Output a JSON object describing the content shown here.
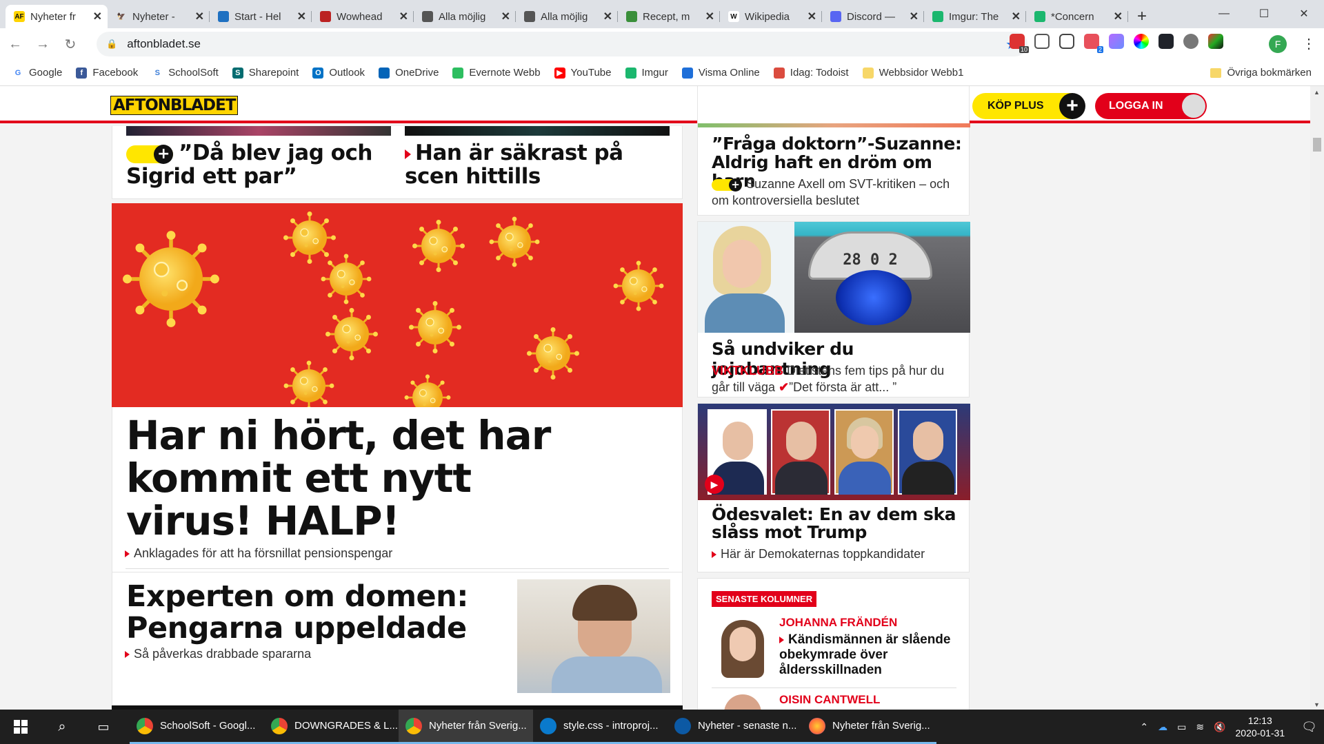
{
  "browser": {
    "tabs": [
      {
        "title": "Nyheter fr",
        "fav": "AF",
        "color": "#ffd400",
        "fcolor": "#111",
        "active": true
      },
      {
        "title": "Nyheter -",
        "fav": "🦅",
        "color": "#dee1e6",
        "fcolor": "#111"
      },
      {
        "title": "Start - Hel",
        "fav": "",
        "color": "#1e70c1",
        "fcolor": "#fff"
      },
      {
        "title": "Wowhead",
        "fav": "",
        "color": "#b22",
        "fcolor": "#fff"
      },
      {
        "title": "Alla möjlig",
        "fav": "",
        "color": "#555",
        "fcolor": "#fff"
      },
      {
        "title": "Alla möjlig",
        "fav": "",
        "color": "#555",
        "fcolor": "#fff"
      },
      {
        "title": "Recept, m",
        "fav": "",
        "color": "#3a8f3a",
        "fcolor": "#fff"
      },
      {
        "title": "Wikipedia",
        "fav": "W",
        "color": "#fff",
        "fcolor": "#111"
      },
      {
        "title": "Discord —",
        "fav": "",
        "color": "#5865f2",
        "fcolor": "#fff"
      },
      {
        "title": "Imgur: The",
        "fav": "",
        "color": "#1bb76e",
        "fcolor": "#fff"
      },
      {
        "title": "*Concern",
        "fav": "",
        "color": "#1bb76e",
        "fcolor": "#fff"
      }
    ],
    "new_tab": "+",
    "window_controls": [
      "—",
      "☐",
      "✕"
    ],
    "url": "aftonbladet.se",
    "profile_initial": "F",
    "ext_badges": {
      "first": "10",
      "second": "2"
    }
  },
  "bookmarks": [
    {
      "label": "Google",
      "icon": "G",
      "color": "#fff",
      "fcolor": "#4285f4"
    },
    {
      "label": "Facebook",
      "icon": "f",
      "color": "#3b5998",
      "fcolor": "#fff"
    },
    {
      "label": "SchoolSoft",
      "icon": "S",
      "color": "#fff",
      "fcolor": "#3b7dd8"
    },
    {
      "label": "Sharepoint",
      "icon": "S",
      "color": "#036c70",
      "fcolor": "#fff"
    },
    {
      "label": "Outlook",
      "icon": "O",
      "color": "#0072c6",
      "fcolor": "#fff"
    },
    {
      "label": "OneDrive",
      "icon": "",
      "color": "#0364b8",
      "fcolor": "#fff"
    },
    {
      "label": "Evernote Webb",
      "icon": "",
      "color": "#2dbe60",
      "fcolor": "#fff"
    },
    {
      "label": "YouTube",
      "icon": "▶",
      "color": "#ff0000",
      "fcolor": "#fff"
    },
    {
      "label": "Imgur",
      "icon": "",
      "color": "#1bb76e",
      "fcolor": "#fff"
    },
    {
      "label": "Visma Online",
      "icon": "",
      "color": "#1e6fd9",
      "fcolor": "#fff"
    },
    {
      "label": "Idag: Todoist",
      "icon": "",
      "color": "#db4c3f",
      "fcolor": "#fff"
    },
    {
      "label": "Webbsidor Webb1",
      "icon": "",
      "color": "#f7d768",
      "fcolor": "#fff"
    }
  ],
  "other_bookmarks": "Övriga bokmärken",
  "site": {
    "logo": "AFTONBLADET",
    "kop_plus": "KÖP PLUS",
    "plus_sign": "+",
    "logga_in": "LOGGA IN"
  },
  "left": {
    "top_a": "”Då blev jag och Sigrid ett par”",
    "top_b": "Han är säkrast på scen hittills",
    "main_headline": "Har ni hört, det har kommit ett nytt virus! HALP!",
    "main_sub": "Anklagades för att ha försnillat pensionspengar",
    "second_headline": "Experten om domen: Pengarna uppeldade",
    "second_sub": "Så påverkas drabbade spararna"
  },
  "right": {
    "card1_title": "”Fråga doktorn”-Suzanne: Aldrig haft en dröm om barn",
    "card1_sub": "Suzanne Axell om SVT-kritiken – och om kontroversiella beslutet",
    "card2_title": "Så undviker du jojobantning",
    "card2_kicker": "VIKTKLUBB",
    "card2_sub": "Dietistens fem tips på hur du går till väga",
    "card2_tail": "”Det första är att... ”",
    "scale_numbers": "28 0 2",
    "card3_title": "Ödesvalet: En av dem ska slåss mot Trump",
    "card3_sub": "Här är Demokaternas toppkandidater",
    "columns_badge": "SENASTE KOLUMNER",
    "col1_author": "JOHANNA FRÄNDÉN",
    "col1_title": "Kändismännen är slående obekymrade över åldersskillnaden",
    "col2_author": "OISIN CANTWELL"
  },
  "taskbar": {
    "items": [
      {
        "label": "SchoolSoft - Googl...",
        "icon": "chrome"
      },
      {
        "label": "DOWNGRADES & L...",
        "icon": "chrome"
      },
      {
        "label": "Nyheter från Sverig...",
        "icon": "chrome",
        "active": true
      },
      {
        "label": "style.css - introproj...",
        "icon": "vscode"
      },
      {
        "label": "Nyheter - senaste n...",
        "icon": "edge"
      },
      {
        "label": "Nyheter från Sverig...",
        "icon": "firefox"
      }
    ],
    "time": "12:13",
    "date": "2020-01-31"
  }
}
